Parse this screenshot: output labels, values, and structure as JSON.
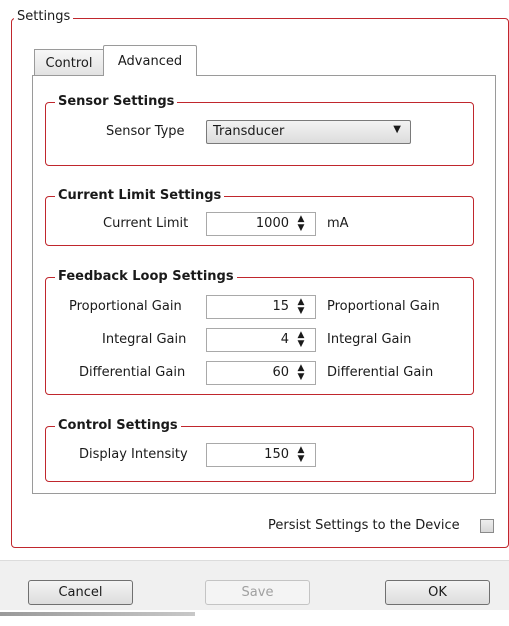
{
  "settings_group": {
    "title": "Settings"
  },
  "tabs": [
    {
      "label": "Control",
      "selected": false
    },
    {
      "label": "Advanced",
      "selected": true
    }
  ],
  "sensor_settings": {
    "title": "Sensor Settings",
    "sensor_type_label": "Sensor Type",
    "sensor_type_value": "Transducer"
  },
  "current_limit_settings": {
    "title": "Current Limit Settings",
    "label": "Current Limit",
    "value": "1000",
    "unit": "mA"
  },
  "feedback_loop_settings": {
    "title": "Feedback Loop Settings",
    "rows": [
      {
        "label": "Proportional Gain",
        "value": "15",
        "suffix": "Proportional Gain"
      },
      {
        "label": "Integral Gain",
        "value": "4",
        "suffix": "Integral Gain"
      },
      {
        "label": "Differential Gain",
        "value": "60",
        "suffix": "Differential Gain"
      }
    ]
  },
  "control_settings": {
    "title": "Control Settings",
    "display_intensity_label": "Display Intensity",
    "display_intensity_value": "150"
  },
  "persist": {
    "label": "Persist Settings to the Device",
    "checked": false
  },
  "buttons": {
    "cancel": "Cancel",
    "save": "Save",
    "ok": "OK"
  },
  "colors": {
    "group_border": "#c0272d",
    "bottom_bar": "#f0f0f0"
  },
  "icons": {
    "dropdown": "▼",
    "spinner_up": "▲",
    "spinner_down": "▼"
  }
}
